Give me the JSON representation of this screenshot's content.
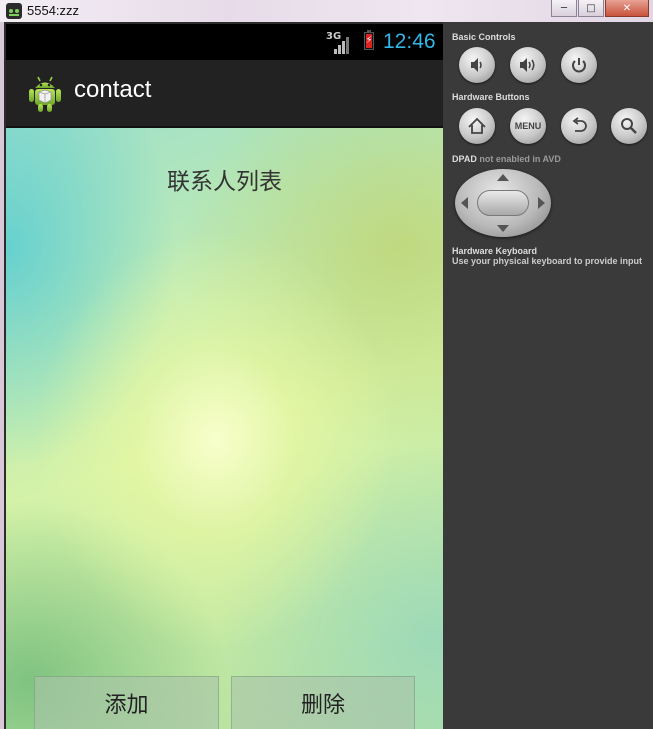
{
  "window": {
    "title": "5554:zzz",
    "minimize_glyph": "─",
    "maximize_glyph": "□",
    "close_glyph": "✕"
  },
  "status_bar": {
    "network": "3G",
    "time": "12:46",
    "battery_glyph": "⚡"
  },
  "action_bar": {
    "app_name": "contact",
    "icon": "android-robot-icon"
  },
  "content": {
    "title": "联系人列表",
    "add_button": "添加",
    "delete_button": "删除"
  },
  "controls": {
    "basic_controls_label": "Basic Controls",
    "hardware_buttons_label": "Hardware Buttons",
    "dpad_label": "DPAD",
    "dpad_status": "not enabled in AVD",
    "keyboard_label": "Hardware Keyboard",
    "keyboard_hint": "Use your physical keyboard to provide input",
    "menu_label": "MENU",
    "basic_icons": [
      "volume-down-icon",
      "volume-up-icon",
      "power-icon"
    ],
    "hardware_icons": [
      "home-icon",
      "menu-icon",
      "back-icon",
      "search-icon"
    ]
  },
  "colors": {
    "clock": "#33b5e5",
    "action_bar": "#222222",
    "panel": "#3a3a3a"
  }
}
